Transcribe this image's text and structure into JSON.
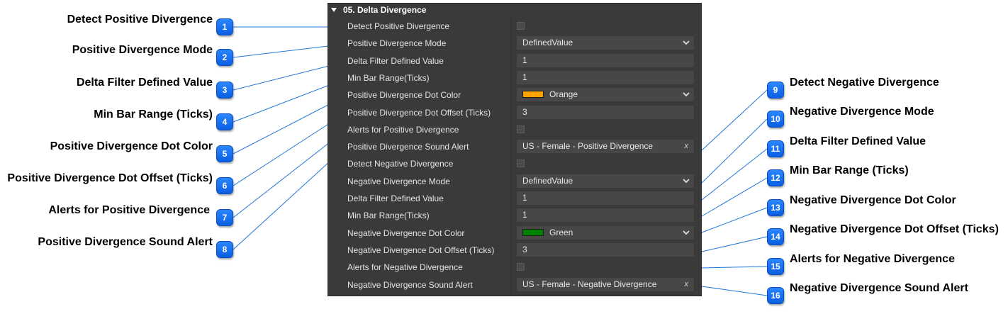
{
  "panel": {
    "title": "05. Delta Divergence",
    "rows": [
      {
        "label": "Detect Positive Divergence",
        "kind": "checkbox"
      },
      {
        "label": "Positive Divergence Mode",
        "kind": "dropdown",
        "value": "DefinedValue"
      },
      {
        "label": "Delta Filter Defined Value",
        "kind": "input",
        "value": "1"
      },
      {
        "label": "Min Bar Range(Ticks)",
        "kind": "input",
        "value": "1"
      },
      {
        "label": "Positive Divergence Dot Color",
        "kind": "color",
        "value": "Orange",
        "color": "#FFA500"
      },
      {
        "label": "Positive Divergence Dot Offset (Ticks)",
        "kind": "input",
        "value": "3"
      },
      {
        "label": "Alerts for Positive Divergence",
        "kind": "checkbox"
      },
      {
        "label": "Positive Divergence Sound Alert",
        "kind": "sound",
        "value": "US - Female - Positive Divergence",
        "clear": "x"
      },
      {
        "label": "Detect Negative Divergence",
        "kind": "checkbox"
      },
      {
        "label": "Negative Divergence Mode",
        "kind": "dropdown",
        "value": "DefinedValue"
      },
      {
        "label": "Delta Filter Defined Value",
        "kind": "input",
        "value": "1"
      },
      {
        "label": "Min Bar Range(Ticks)",
        "kind": "input",
        "value": "1"
      },
      {
        "label": "Negative Divergence Dot Color",
        "kind": "color",
        "value": "Green",
        "color": "#008000"
      },
      {
        "label": "Negative Divergence Dot Offset (Ticks)",
        "kind": "input",
        "value": "3"
      },
      {
        "label": "Alerts for Negative Divergence",
        "kind": "checkbox"
      },
      {
        "label": "Negative Divergence Sound Alert",
        "kind": "sound",
        "value": "US - Female - Negative Divergence",
        "clear": "x"
      }
    ]
  },
  "callouts": [
    {
      "number": "1",
      "label": "Detect Positive Divergence"
    },
    {
      "number": "2",
      "label": "Positive Divergence Mode"
    },
    {
      "number": "3",
      "label": "Delta Filter Defined Value"
    },
    {
      "number": "4",
      "label": "Min Bar Range (Ticks)"
    },
    {
      "number": "5",
      "label": "Positive Divergence Dot Color"
    },
    {
      "number": "6",
      "label": "Positive Divergence Dot Offset (Ticks)"
    },
    {
      "number": "7",
      "label": "Alerts for Positive Divergence"
    },
    {
      "number": "8",
      "label": "Positive Divergence Sound Alert"
    },
    {
      "number": "9",
      "label": "Detect Negative Divergence"
    },
    {
      "number": "10",
      "label": "Negative Divergence Mode"
    },
    {
      "number": "11",
      "label": "Delta Filter Defined Value"
    },
    {
      "number": "12",
      "label": "Min Bar Range (Ticks)"
    },
    {
      "number": "13",
      "label": "Negative Divergence Dot Color"
    },
    {
      "number": "14",
      "label": "Negative Divergence Dot Offset (Ticks)"
    },
    {
      "number": "15",
      "label": "Alerts for Negative Divergence"
    },
    {
      "number": "16",
      "label": "Negative Divergence Sound Alert"
    }
  ],
  "colors": {
    "badge": "#1a73f0",
    "connector": "#1f77d8"
  },
  "icons": {
    "collapse": "triangle-down-icon",
    "dropdown": "chevron-down-icon",
    "clear": "clear-x-icon"
  }
}
